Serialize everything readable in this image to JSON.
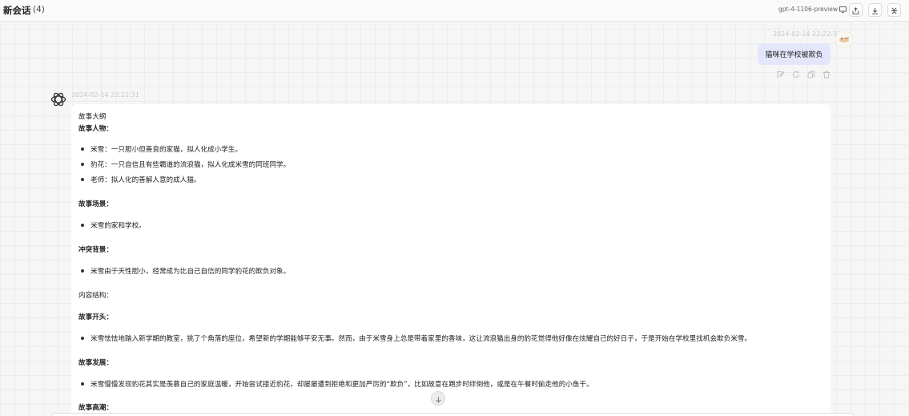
{
  "header": {
    "title": "新会话",
    "count": "(4)",
    "model": "gpt-4-1106-preview"
  },
  "icons": {
    "monitor": "monitor-icon",
    "share": "share-icon",
    "download": "download-icon",
    "collapse": "collapse-icon",
    "edit": "edit-icon",
    "refresh": "refresh-icon",
    "copy": "copy-icon",
    "delete": "delete-icon",
    "bot": "openai-logo-icon",
    "scroll": "arrow-down-icon"
  },
  "user_message": {
    "time": "2024-02-14 22:22:31",
    "text": "猫咪在学校被欺负"
  },
  "bot_message": {
    "time": "2024-02-14 22:22:31",
    "lines": {
      "l0": "故事大纲",
      "l1": "故事人物：",
      "l2": "米雪：一只胆小但善良的家猫，拟人化成小学生。",
      "l3": "豹花：一只自信且有些霸道的流浪猫，拟人化成米雪的同班同学。",
      "l4": "老师：拟人化的善解人意的成人猫。",
      "l5": "故事场景：",
      "l6": "米雪的家和学校。",
      "l7": "冲突背景：",
      "l8": "米雪由于天性胆小，经常成为比自己自信的同学豹花的欺负对象。",
      "l9": "内容结构：",
      "l10": "故事开头：",
      "l11": "米雪怯怯地踏入新学期的教室，挑了个角落的座位，希望新的学期能够平安无事。然而，由于米雪身上总是带着家里的香味，这让流浪猫出身的豹花觉得他好像在炫耀自己的好日子，于是开始在学校里找机会欺负米雪。",
      "l12": "故事发展：",
      "l13": "米雪慢慢发现豹花其实是羡慕自己的家庭温暖，开始尝试接近豹花，却屡屡遭到拒绝和更加严厉的“欺负”，比如故意在跑步时绊倒他，或是在午餐时偷走他的小鱼干。",
      "l14": "故事高潮："
    }
  }
}
